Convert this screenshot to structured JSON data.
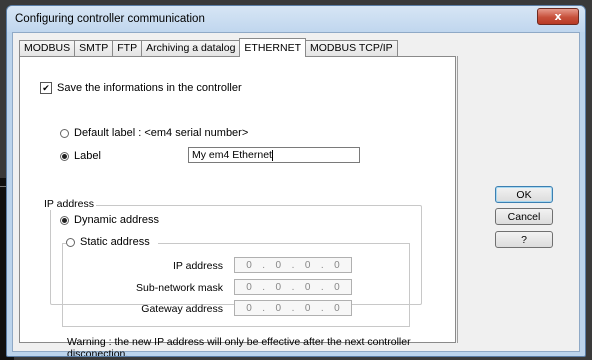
{
  "window": {
    "title": "Configuring controller communication",
    "close_glyph": "x"
  },
  "tabs": [
    {
      "label": "MODBUS"
    },
    {
      "label": "SMTP"
    },
    {
      "label": "FTP"
    },
    {
      "label": "Archiving a datalog"
    },
    {
      "label": "ETHERNET",
      "active": true
    },
    {
      "label": "MODBUS TCP/IP"
    }
  ],
  "ethernet": {
    "save_checkbox": {
      "label": "Save the informations in the controller",
      "checked": true,
      "check_glyph": "✔"
    },
    "default_label_radio": {
      "label": "Default label : <em4 serial number>",
      "selected": false
    },
    "label_radio": {
      "label": "Label",
      "selected": true
    },
    "label_input_value": "My em4 Ethernet",
    "ip_group_title": "IP address",
    "dynamic_radio": {
      "label": "Dynamic address",
      "selected": true
    },
    "static_radio": {
      "label": "Static address",
      "selected": false
    },
    "fields": {
      "ip": {
        "label": "IP address",
        "value": [
          "0",
          "0",
          "0",
          "0"
        ]
      },
      "mask": {
        "label": "Sub-network mask",
        "value": [
          "0",
          "0",
          "0",
          "0"
        ]
      },
      "gateway": {
        "label": "Gateway address",
        "value": [
          "0",
          "0",
          "0",
          "0"
        ]
      }
    },
    "ip_separator": ".",
    "warning": "Warning : the new IP address will only be effective after the next controller disconection."
  },
  "buttons": {
    "ok": "OK",
    "cancel": "Cancel",
    "help": "?"
  },
  "colors": {
    "close_button": "#c7503b",
    "default_button_border": "#3c7fb1"
  }
}
